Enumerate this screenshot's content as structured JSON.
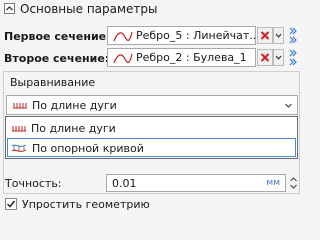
{
  "section": {
    "title": "Основные параметры"
  },
  "first_section": {
    "label": "Первое сечение:",
    "value": "Ребро_5 : Линейчат..."
  },
  "second_section": {
    "label": "Второе сечение:",
    "value": "Ребро_2 : Булева_1"
  },
  "alignment": {
    "title": "Выравнивание",
    "selected": "По длине дуги",
    "options": [
      "По длине дуги",
      "По опорной кривой"
    ]
  },
  "accuracy": {
    "label": "Точность:",
    "value": "0.01",
    "unit": "мм"
  },
  "simplify": {
    "label": "Упростить геометрию",
    "checked": true
  },
  "colors": {
    "accent": "#3a7ad0",
    "delete_red": "#d22020",
    "selection_border": "#4a8ad6"
  }
}
